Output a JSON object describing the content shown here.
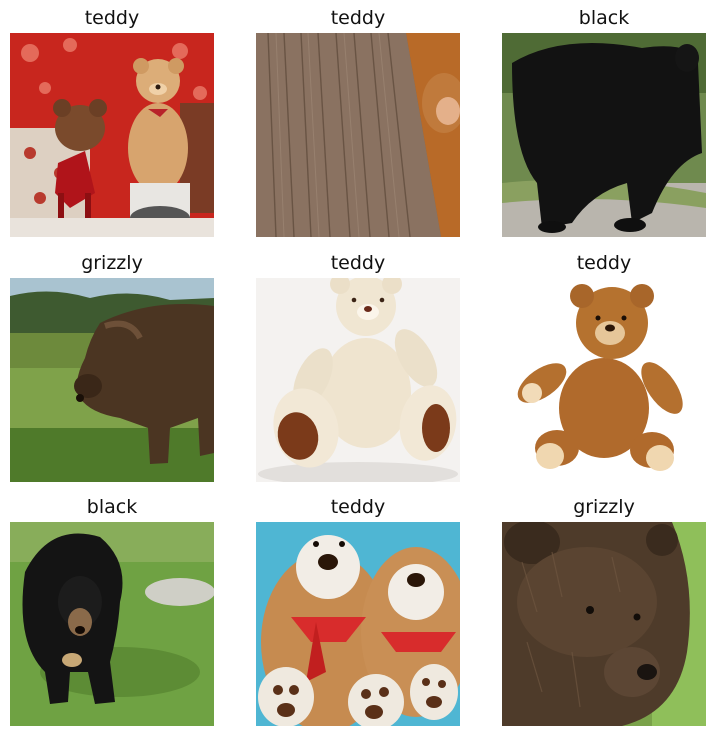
{
  "grid": {
    "items": [
      {
        "label": "teddy"
      },
      {
        "label": "teddy"
      },
      {
        "label": "black"
      },
      {
        "label": "grizzly"
      },
      {
        "label": "teddy"
      },
      {
        "label": "teddy"
      },
      {
        "label": "black"
      },
      {
        "label": "teddy"
      },
      {
        "label": "grizzly"
      }
    ]
  }
}
